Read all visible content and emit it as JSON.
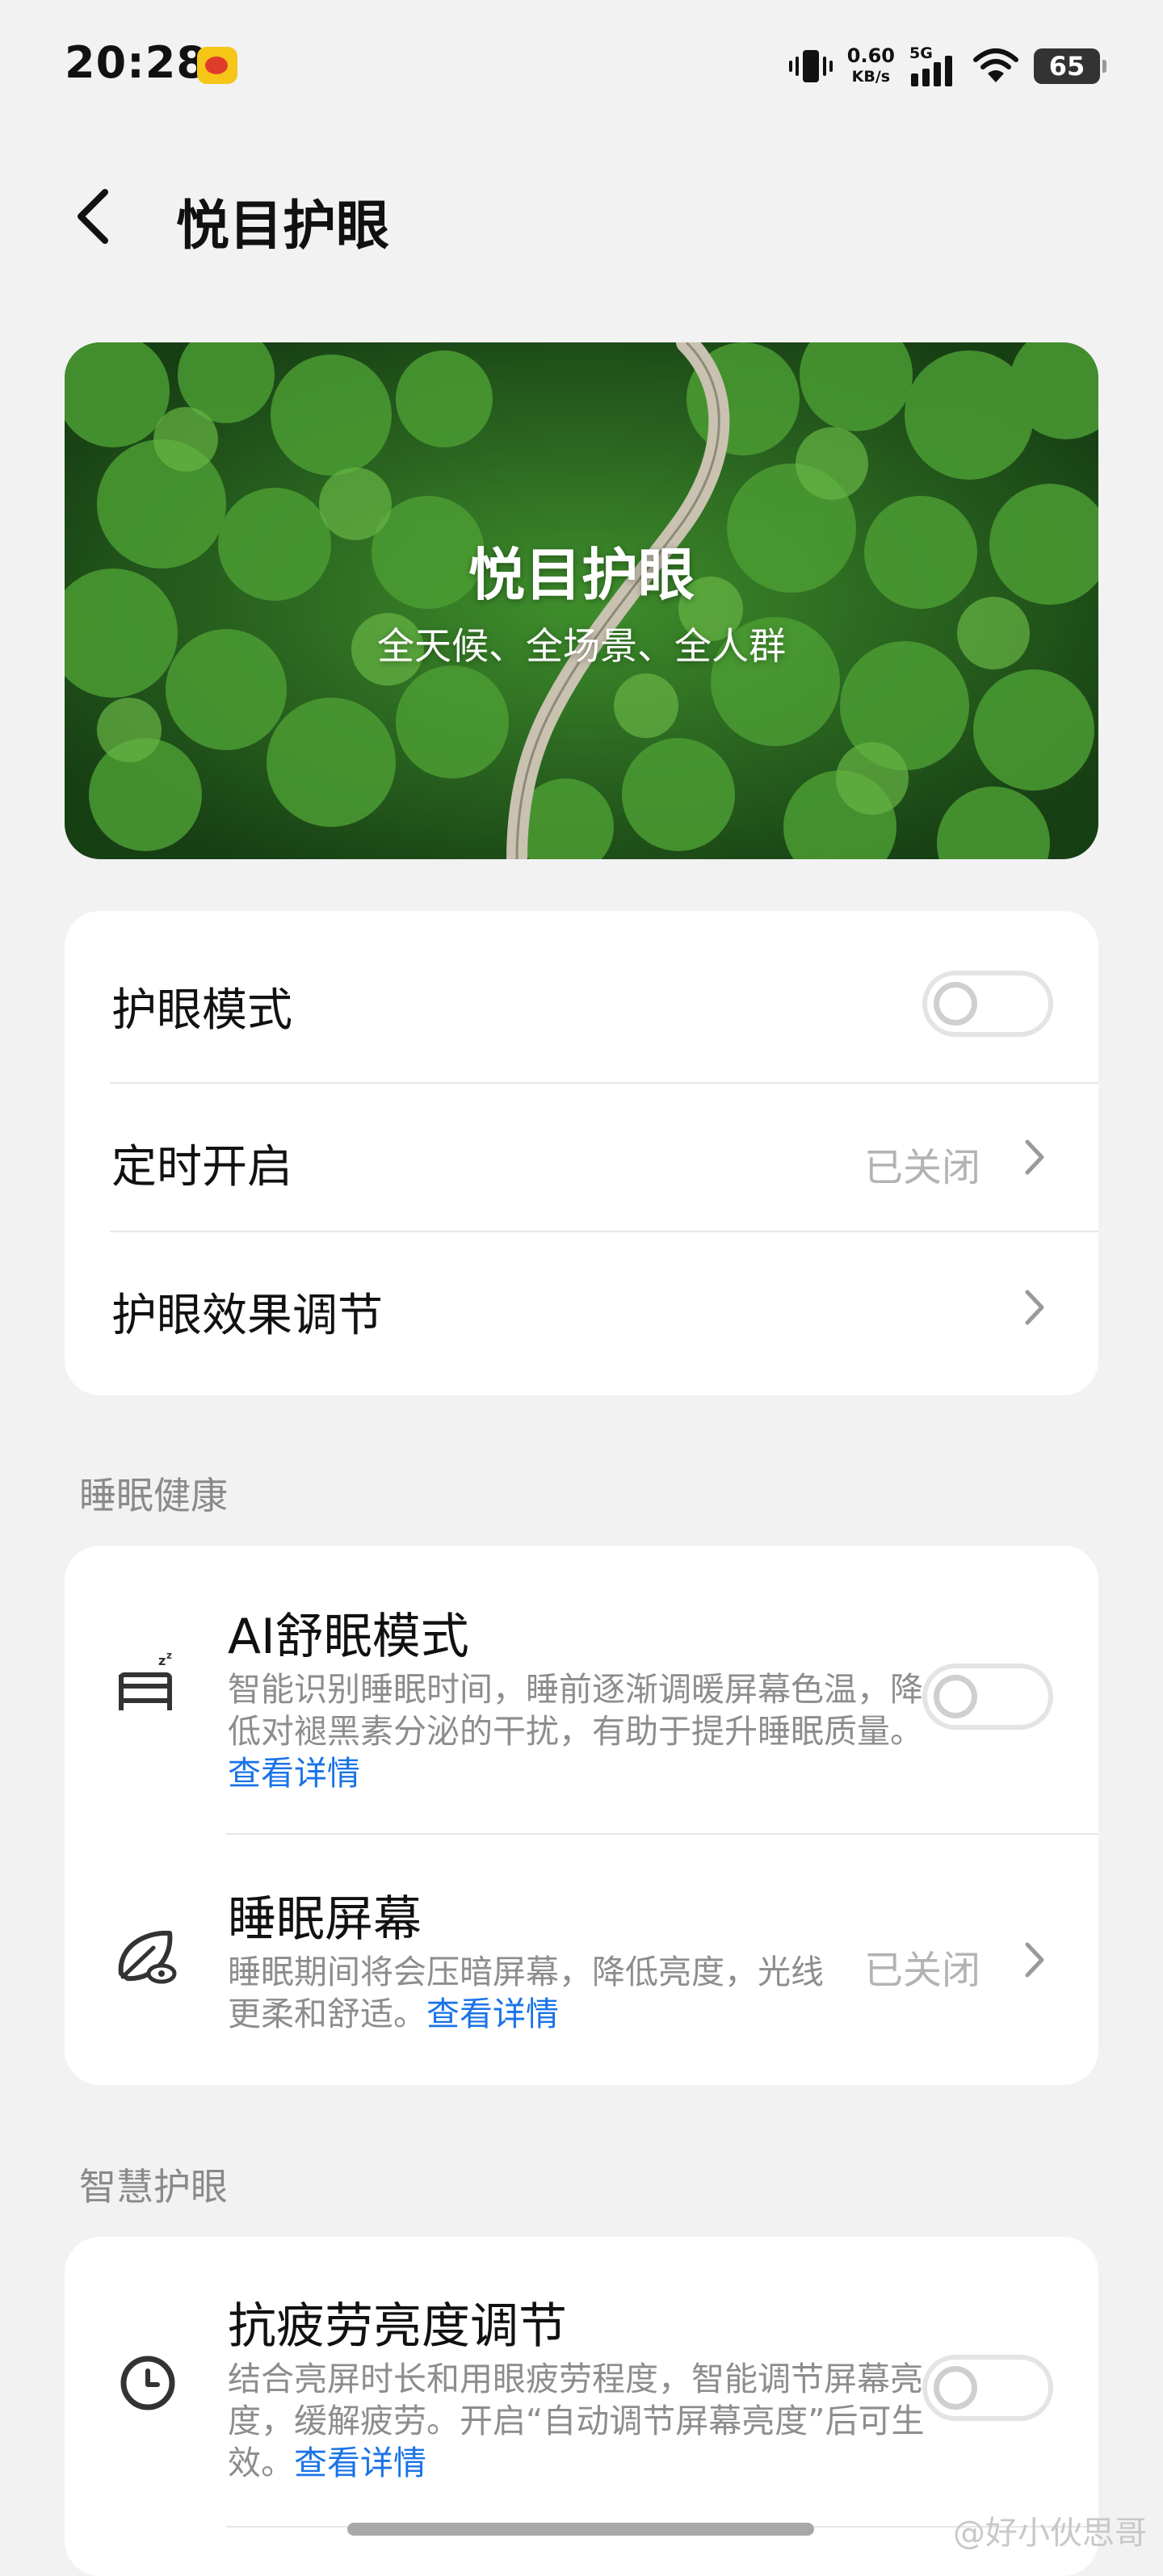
{
  "status_bar": {
    "time": "20:28",
    "net_speed": "0.60",
    "net_unit": "KB/s",
    "network_type": "5G",
    "battery": "65"
  },
  "header": {
    "title": "悦目护眼"
  },
  "banner": {
    "title": "悦目护眼",
    "subtitle": "全天候、全场景、全人群"
  },
  "main_settings": {
    "eye_mode": {
      "label": "护眼模式",
      "enabled": false
    },
    "schedule": {
      "label": "定时开启",
      "value": "已关闭"
    },
    "effect": {
      "label": "护眼效果调节"
    }
  },
  "sleep_section": {
    "title": "睡眠健康",
    "ai_sleep": {
      "title": "AI舒眠模式",
      "desc": "智能识别睡眠时间，睡前逐渐调暖屏幕色温，降低对褪黑素分泌的干扰，有助于提升睡眠质量。",
      "link": "查看详情",
      "enabled": false
    },
    "sleep_screen": {
      "title": "睡眠屏幕",
      "desc": "睡眠期间将会压暗屏幕，降低亮度，光线更柔和舒适。",
      "link": "查看详情",
      "value": "已关闭"
    }
  },
  "smart_section": {
    "title": "智慧护眼",
    "anti_fatigue": {
      "title": "抗疲劳亮度调节",
      "desc": "结合亮屏时长和用眼疲劳程度，智能调节屏幕亮度，缓解疲劳。开启“自动调节屏幕亮度”后可生效。",
      "link": "查看详情",
      "enabled": false
    }
  },
  "watermark": "@好小伙思哥"
}
